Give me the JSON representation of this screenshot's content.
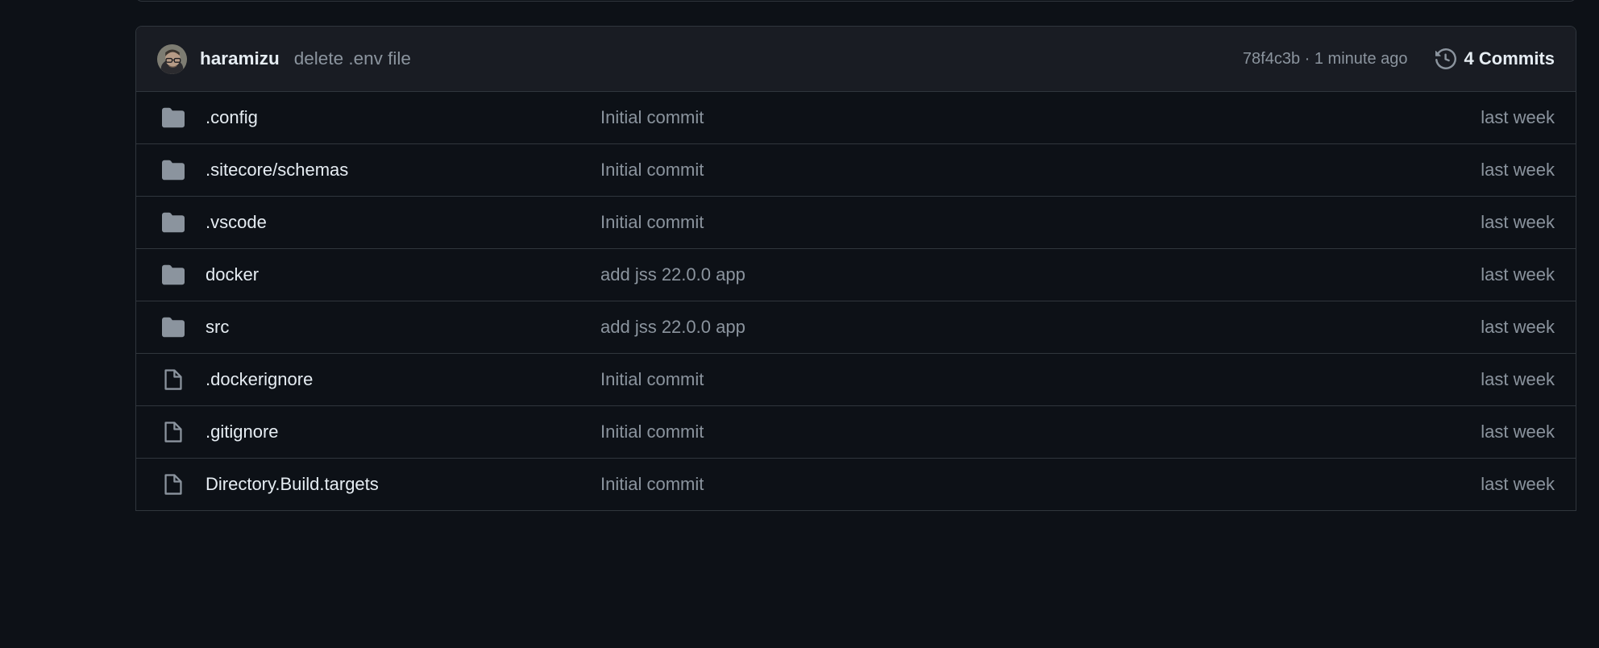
{
  "panel": {
    "latest_commit": {
      "avatar_name": "user-avatar",
      "author": "haramizu",
      "message": "delete .env file",
      "meta": "78f4c3b · 1 minute ago",
      "commits_label": "4 Commits",
      "commits_icon": "history-icon"
    },
    "rows": [
      {
        "icon": "folder-icon",
        "name": ".config",
        "message": "Initial commit",
        "age": "last week"
      },
      {
        "icon": "folder-icon",
        "name": ".sitecore/schemas",
        "message": "Initial commit",
        "age": "last week"
      },
      {
        "icon": "folder-icon",
        "name": ".vscode",
        "message": "Initial commit",
        "age": "last week"
      },
      {
        "icon": "folder-icon",
        "name": "docker",
        "message": "add jss 22.0.0 app",
        "age": "last week"
      },
      {
        "icon": "folder-icon",
        "name": "src",
        "message": "add jss 22.0.0 app",
        "age": "last week"
      },
      {
        "icon": "file-icon",
        "name": ".dockerignore",
        "message": "Initial commit",
        "age": "last week"
      },
      {
        "icon": "file-icon",
        "name": ".gitignore",
        "message": "Initial commit",
        "age": "last week"
      },
      {
        "icon": "file-icon",
        "name": "Directory.Build.targets",
        "message": "Initial commit",
        "age": "last week"
      }
    ]
  },
  "colors": {
    "page_background": "#0d1117",
    "row_background": "#0d1117",
    "header_background": "#191c23",
    "border": "#30363d",
    "text_primary": "#e6edf3",
    "text_muted": "#8b949e",
    "icon_muted": "#8b949e"
  }
}
